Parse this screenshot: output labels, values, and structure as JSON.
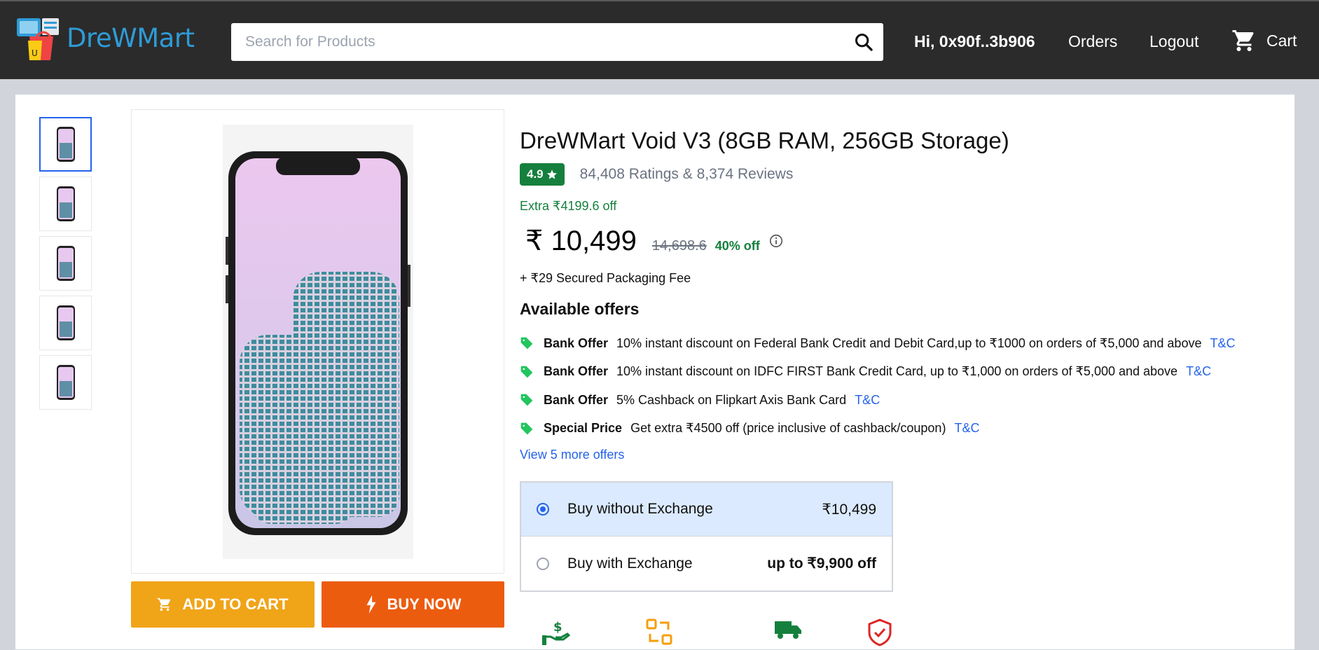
{
  "header": {
    "logo_text": "DreWMart",
    "search_placeholder": "Search for Products",
    "greeting": "Hi, 0x90f..3b906",
    "orders_label": "Orders",
    "logout_label": "Logout",
    "cart_label": "Cart"
  },
  "product": {
    "title": "DreWMart Void V3 (8GB RAM, 256GB Storage)",
    "rating": "4.9",
    "ratings_reviews": "84,408 Ratings & 8,374 Reviews",
    "extra_off": "Extra ₹4199.6 off",
    "price": "₹ 10,499",
    "mrp": "14,698.6",
    "discount": "40% off",
    "packaging_fee": "+ ₹29 Secured Packaging Fee"
  },
  "offers": {
    "title": "Available offers",
    "items": [
      {
        "type": "Bank Offer",
        "text": "10% instant discount on Federal Bank Credit and Debit Card,up to ₹1000 on orders of ₹5,000 and above",
        "tnc": "T&C"
      },
      {
        "type": "Bank Offer",
        "text": "10% instant discount on IDFC FIRST Bank Credit Card, up to ₹1,000 on orders of ₹5,000 and above",
        "tnc": "T&C"
      },
      {
        "type": "Bank Offer",
        "text": "5% Cashback on Flipkart Axis Bank Card",
        "tnc": "T&C"
      },
      {
        "type": "Special Price",
        "text": "Get extra ₹4500 off (price inclusive of cashback/coupon)",
        "tnc": "T&C"
      }
    ],
    "view_more": "View 5 more offers"
  },
  "exchange": {
    "options": [
      {
        "label": "Buy without Exchange",
        "value": "₹10,499",
        "selected": true
      },
      {
        "label": "Buy with Exchange",
        "value": "up to ₹9,900 off",
        "selected": false
      }
    ]
  },
  "actions": {
    "add_to_cart": "ADD TO CART",
    "buy_now": "BUY NOW"
  },
  "colors": {
    "header_bg": "#2b2b2b",
    "brand_blue": "#2f9bd6",
    "add_to_cart": "#f0a418",
    "buy_now": "#ec5c0f",
    "rating_green": "#15803d",
    "link_blue": "#2563eb"
  },
  "icons": [
    "shopping-bag-logo-icon",
    "search-icon",
    "cart-icon",
    "star-icon",
    "info-icon",
    "offer-tag-icon",
    "lightning-icon",
    "cash-hand-icon",
    "exchange-icon",
    "delivery-truck-icon",
    "shield-check-icon"
  ]
}
